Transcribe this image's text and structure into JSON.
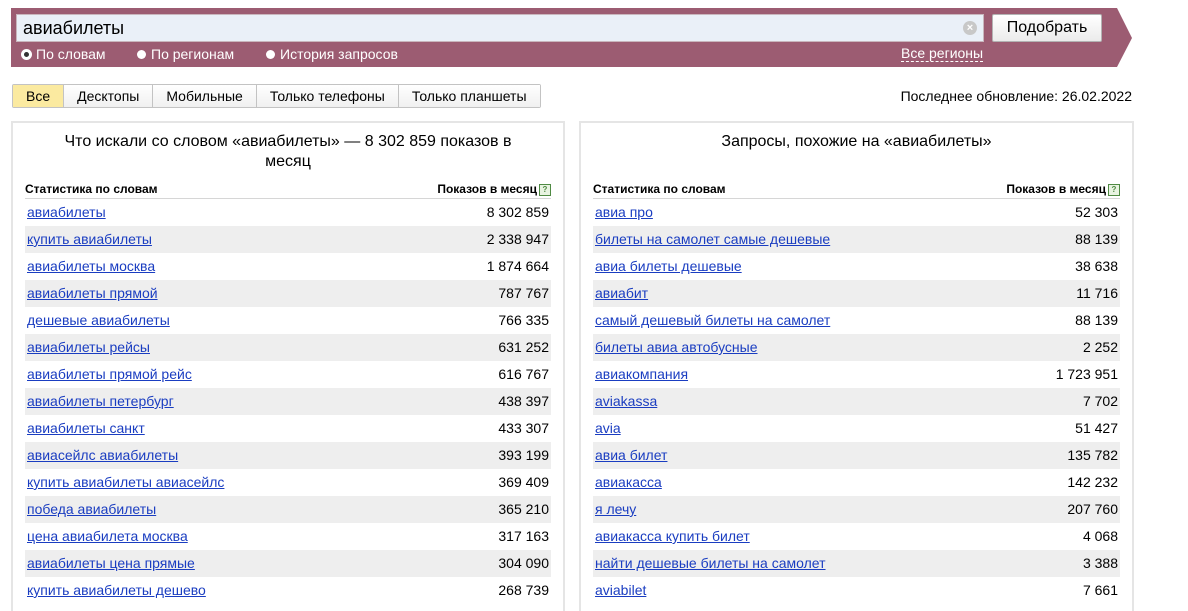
{
  "search": {
    "query": "авиабилеты",
    "submit_label": "Подобрать",
    "modes": [
      {
        "label": "По словам",
        "checked": true
      },
      {
        "label": "По регионам",
        "checked": false
      },
      {
        "label": "История запросов",
        "checked": false
      }
    ],
    "regions_link": "Все регионы"
  },
  "device_tabs": [
    "Все",
    "Десктопы",
    "Мобильные",
    "Только телефоны",
    "Только планшеты"
  ],
  "last_update": "Последнее обновление: 26.02.2022",
  "left_panel": {
    "title": "Что искали со словом «авиабилеты» — 8 302 859 показов в месяц",
    "col_phrase": "Статистика по словам",
    "col_count": "Показов в месяц",
    "rows": [
      {
        "phrase": "авиабилеты",
        "count": "8 302 859"
      },
      {
        "phrase": "купить авиабилеты",
        "count": "2 338 947"
      },
      {
        "phrase": "авиабилеты москва",
        "count": "1 874 664"
      },
      {
        "phrase": "авиабилеты прямой",
        "count": "787 767"
      },
      {
        "phrase": "дешевые авиабилеты",
        "count": "766 335"
      },
      {
        "phrase": "авиабилеты рейсы",
        "count": "631 252"
      },
      {
        "phrase": "авиабилеты прямой рейс",
        "count": "616 767"
      },
      {
        "phrase": "авиабилеты петербург",
        "count": "438 397"
      },
      {
        "phrase": "авиабилеты санкт",
        "count": "433 307"
      },
      {
        "phrase": "авиасейлс авиабилеты",
        "count": "393 199"
      },
      {
        "phrase": "купить авиабилеты авиасейлс",
        "count": "369 409"
      },
      {
        "phrase": "победа авиабилеты",
        "count": "365 210"
      },
      {
        "phrase": "цена авиабилета москва",
        "count": "317 163"
      },
      {
        "phrase": "авиабилеты цена прямые",
        "count": "304 090"
      },
      {
        "phrase": "купить авиабилеты дешево",
        "count": "268 739"
      }
    ]
  },
  "right_panel": {
    "title": "Запросы, похожие на «авиабилеты»",
    "col_phrase": "Статистика по словам",
    "col_count": "Показов в месяц",
    "rows": [
      {
        "phrase": "авиа про",
        "count": "52 303"
      },
      {
        "phrase": "билеты на самолет самые дешевые",
        "count": "88 139"
      },
      {
        "phrase": "авиа билеты дешевые",
        "count": "38 638"
      },
      {
        "phrase": "авиабит",
        "count": "11 716"
      },
      {
        "phrase": "самый дешевый билеты на самолет",
        "count": "88 139"
      },
      {
        "phrase": "билеты авиа автобусные",
        "count": "2 252"
      },
      {
        "phrase": "авиакомпания",
        "count": "1 723 951"
      },
      {
        "phrase": "aviakassa",
        "count": "7 702"
      },
      {
        "phrase": "avia",
        "count": "51 427"
      },
      {
        "phrase": "авиа билет",
        "count": "135 782"
      },
      {
        "phrase": "авиакасса",
        "count": "142 232"
      },
      {
        "phrase": "я лечу",
        "count": "207 760"
      },
      {
        "phrase": "авиакасса купить билет",
        "count": "4 068"
      },
      {
        "phrase": "найти дешевые билеты на самолет",
        "count": "3 388"
      },
      {
        "phrase": "aviabilet",
        "count": "7 661"
      }
    ]
  }
}
